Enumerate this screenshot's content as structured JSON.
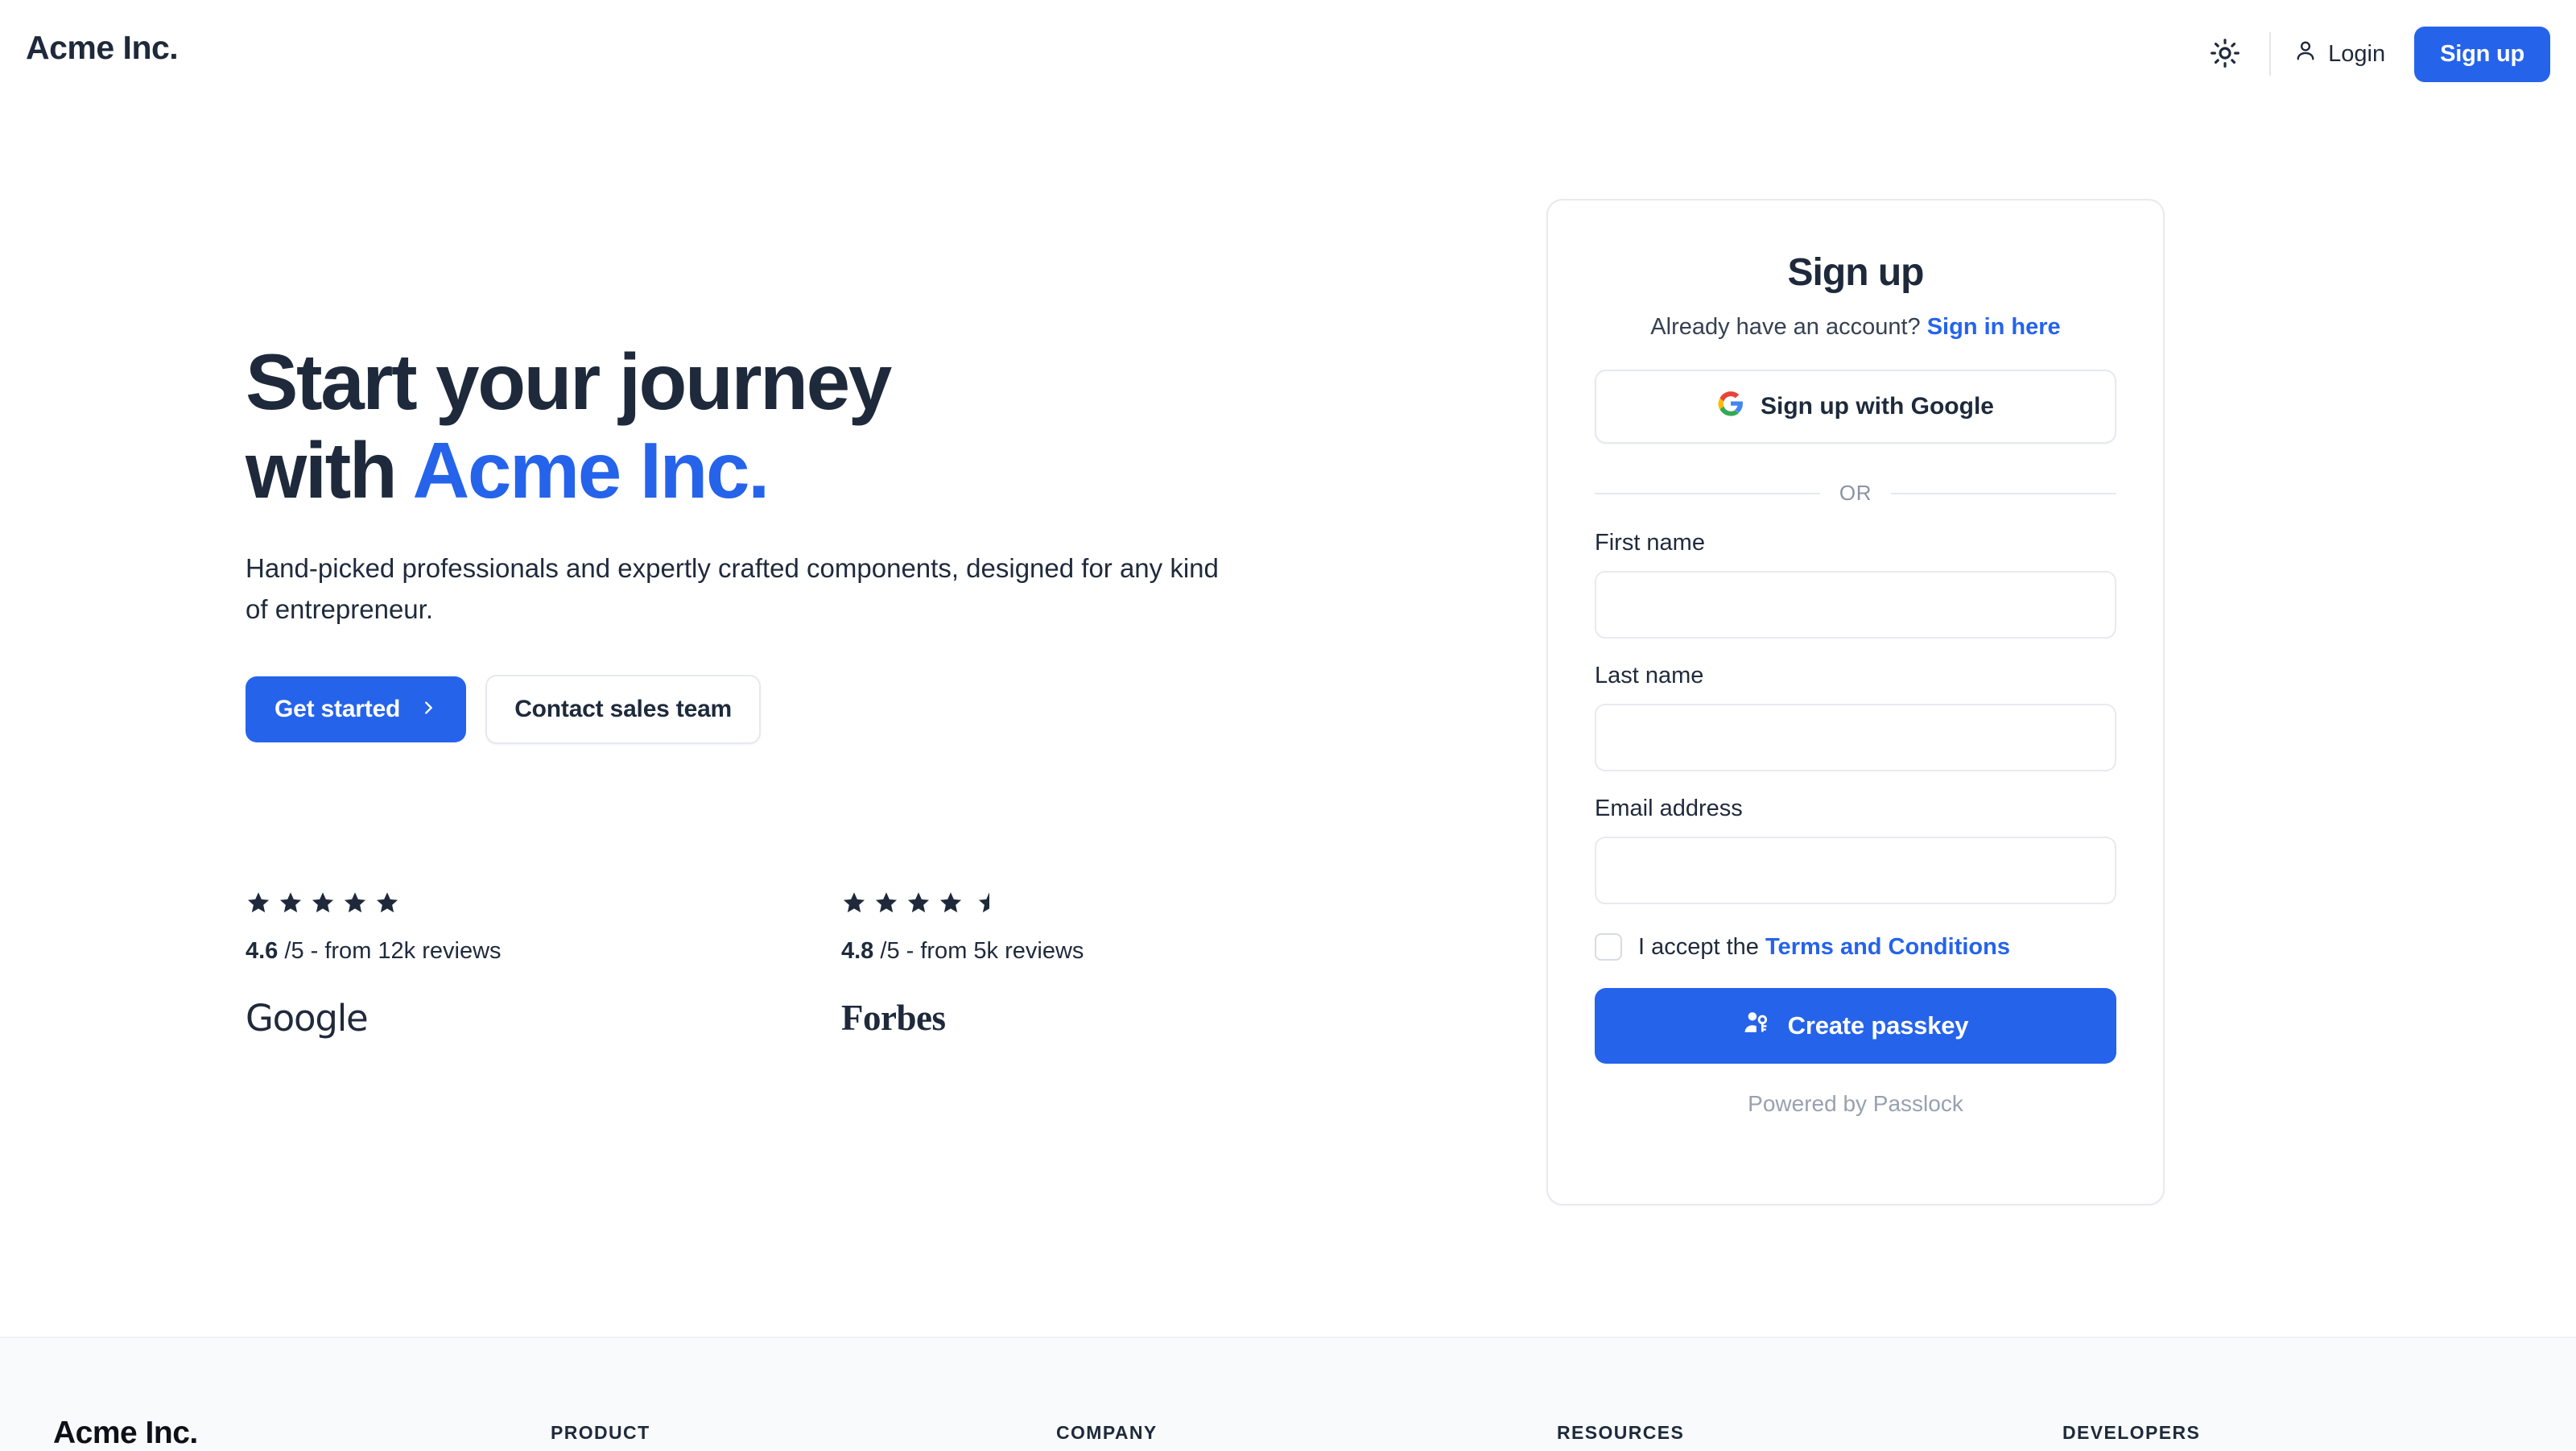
{
  "header": {
    "brand": "Acme Inc.",
    "theme_toggle_icon": "sun-icon",
    "login_icon": "user-icon",
    "login_label": "Login",
    "signup_label": "Sign up"
  },
  "hero": {
    "heading_line1": "Start your journey",
    "heading_line2_prefix": "with ",
    "heading_line2_accent": "Acme Inc.",
    "subtitle": "Hand-picked professionals and expertly crafted components, designed for any kind of entrepreneur.",
    "primary_cta": "Get started",
    "primary_cta_icon": "chevron-right-icon",
    "secondary_cta": "Contact sales team"
  },
  "ratings": [
    {
      "stars_full": 5,
      "stars_half": 0,
      "score": "4.6",
      "suffix": "/5 - from 12k reviews",
      "brand": "Google"
    },
    {
      "stars_full": 4,
      "stars_half": 1,
      "score": "4.8",
      "suffix": "/5 - from 5k reviews",
      "brand": "Forbes"
    }
  ],
  "signup_card": {
    "title": "Sign up",
    "subtitle_text": "Already have an account? ",
    "signin_link": "Sign in here",
    "google_button_label": "Sign up with Google",
    "google_icon": "google-g-icon",
    "divider_label": "OR",
    "fields": [
      {
        "label": "First name",
        "value": "",
        "placeholder": ""
      },
      {
        "label": "Last name",
        "value": "",
        "placeholder": ""
      },
      {
        "label": "Email address",
        "value": "",
        "placeholder": ""
      }
    ],
    "terms_checked": false,
    "terms_text": "I accept the ",
    "terms_link": "Terms and Conditions",
    "submit_label": "Create passkey",
    "submit_icon": "user-key-icon",
    "powered_by": "Powered by Passlock"
  },
  "footer": {
    "brand": "Acme Inc.",
    "columns": [
      {
        "title": "PRODUCT"
      },
      {
        "title": "COMPANY"
      },
      {
        "title": "RESOURCES"
      },
      {
        "title": "DEVELOPERS"
      }
    ]
  },
  "colors": {
    "accent_blue": "#2563eb",
    "text_dark": "#1e2a3b",
    "border_light": "#e8eaef",
    "footer_bg": "#f8fafc",
    "muted": "#98a1b0"
  }
}
